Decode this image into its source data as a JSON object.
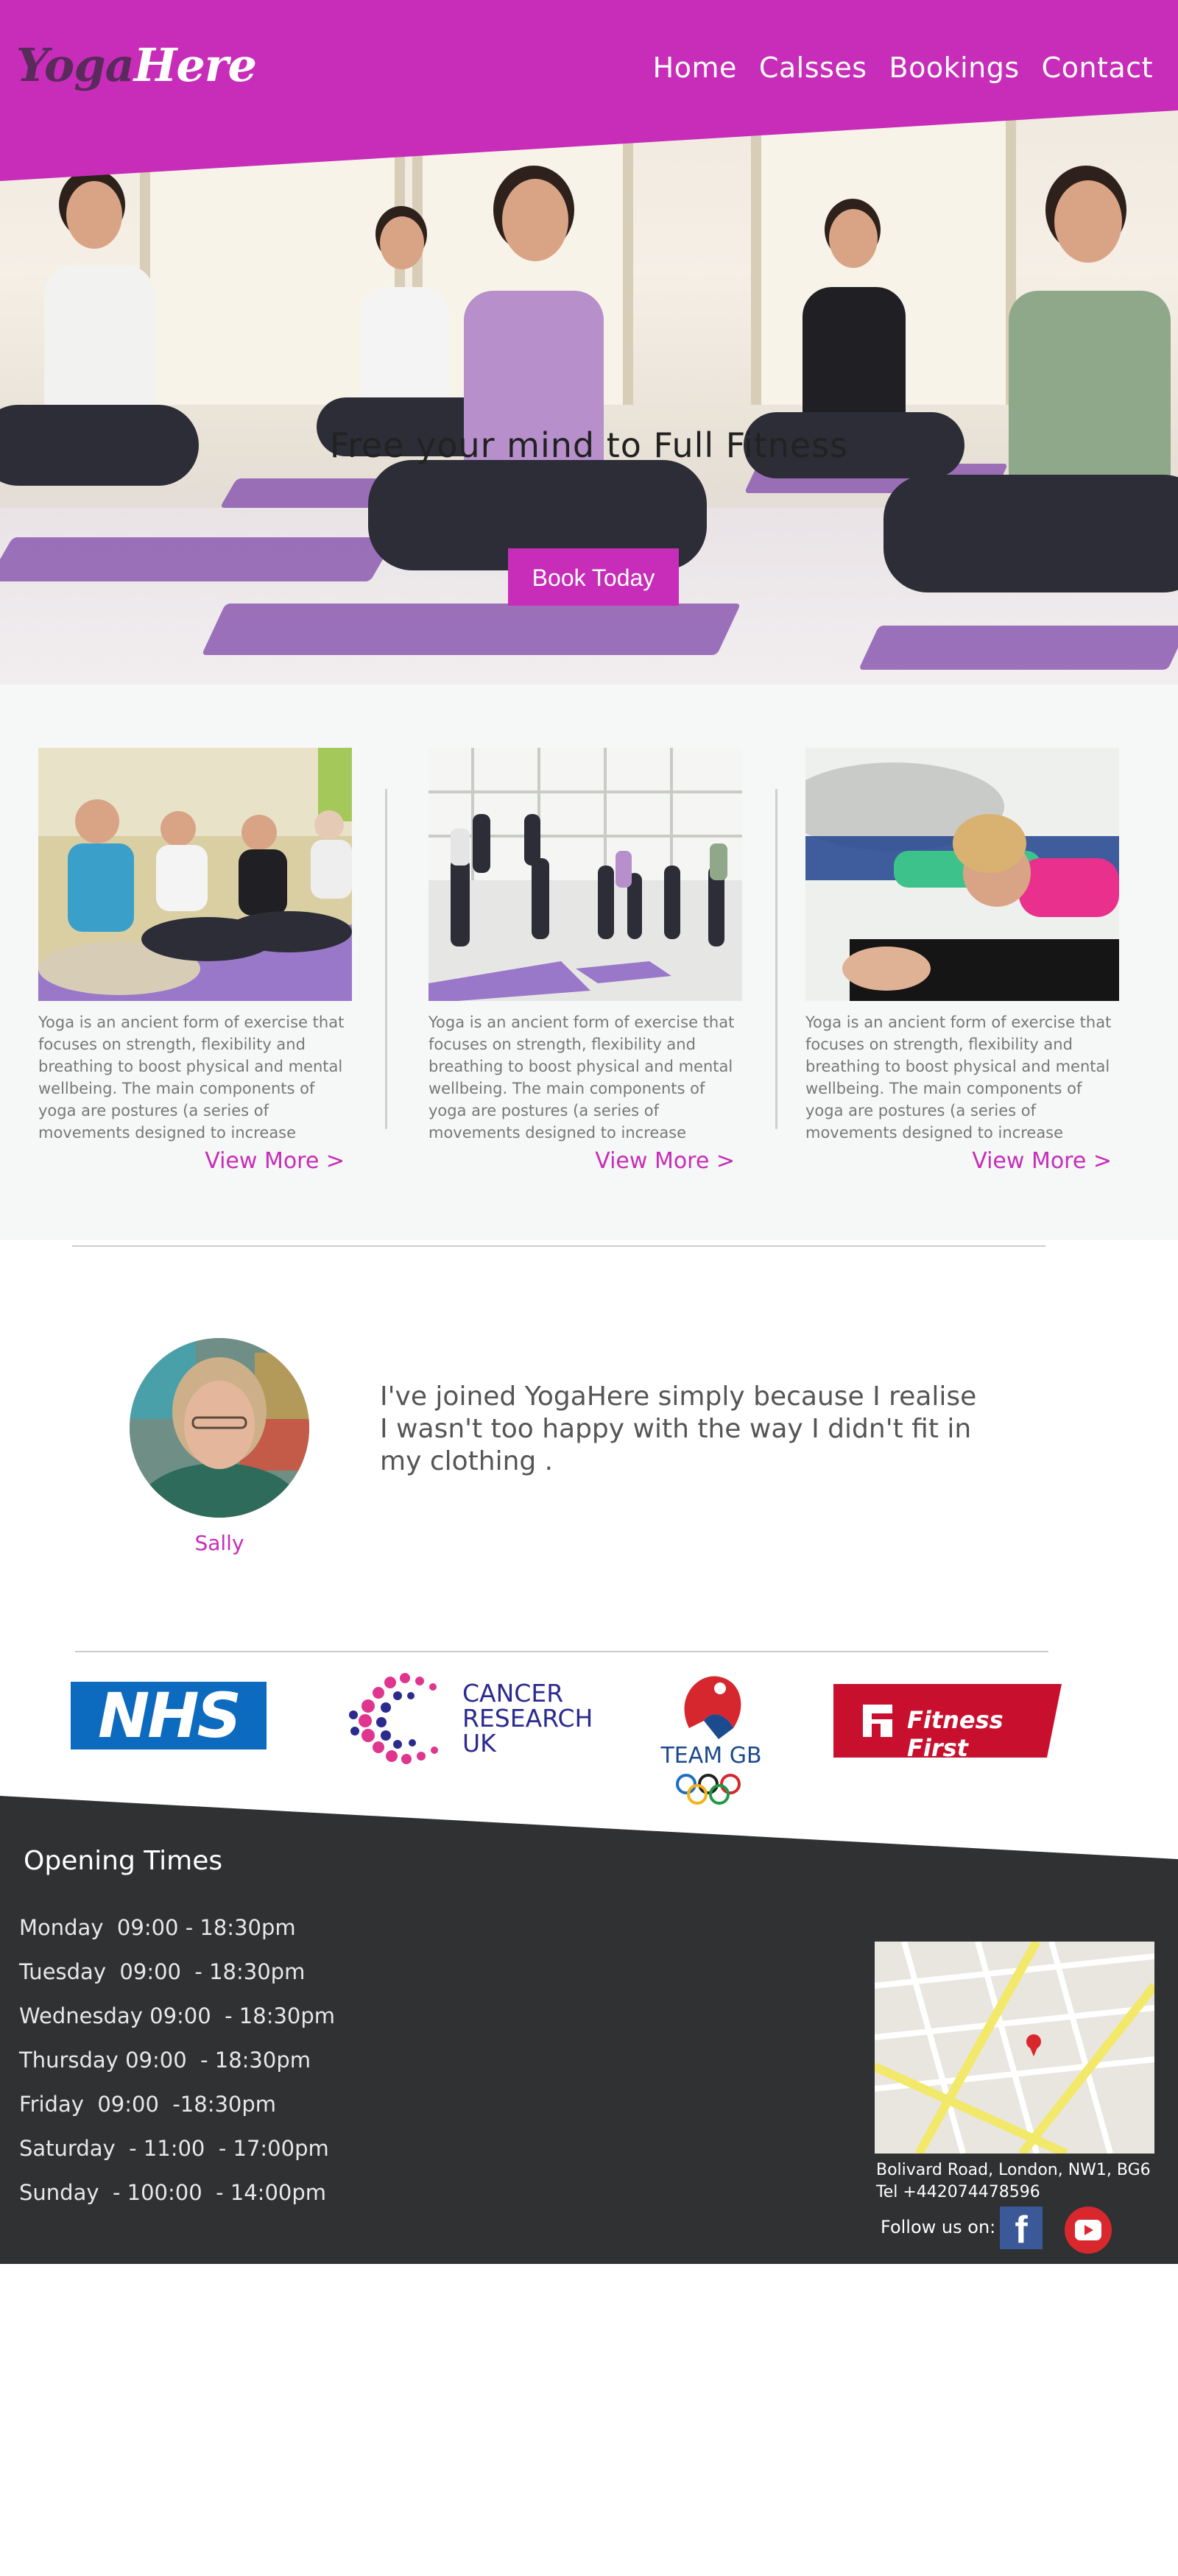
{
  "brand": {
    "logo_part1": "Yoga",
    "logo_part2": "Here",
    "accent_color": "#c72db8",
    "footer_color": "#2f3132"
  },
  "nav": [
    {
      "label": "Home"
    },
    {
      "label": "Calsses"
    },
    {
      "label": "Bookings"
    },
    {
      "label": "Contact"
    }
  ],
  "hero": {
    "title": "Free your mind to Full Fitness",
    "button_label": "Book Today",
    "slides_total": 3,
    "active_slide": 1
  },
  "cards": [
    {
      "image_desc": "seated-yoga-class-photo",
      "text": "Yoga is an ancient form of exercise that focuses on strength, flexibility and breathing to boost physical and mental wellbeing. The main components of yoga are postures (a series of movements designed to increase",
      "link_label": "View More >"
    },
    {
      "image_desc": "standing-yoga-class-photo",
      "text": "Yoga is an ancient form of exercise that focuses on strength, flexibility and breathing to boost physical and mental wellbeing. The main components of yoga are postures (a series of movements designed to increase",
      "link_label": "View More >"
    },
    {
      "image_desc": "stretching-class-photo",
      "text": "Yoga is an ancient form of exercise that focuses on strength, flexibility and breathing to boost physical and mental wellbeing. The main components of yoga are postures (a series of movements designed to increase",
      "link_label": "View More >"
    }
  ],
  "testimonial": {
    "name": "Sally",
    "quote": "I've joined YogaHere simply because I realise I wasn't too happy with the way I didn't fit in my clothing ."
  },
  "partners": {
    "nhs": "NHS",
    "cancer_research": [
      "CANCER",
      "RESEARCH",
      "UK"
    ],
    "team_gb": "TEAM GB",
    "fitness_first": "Fitness First"
  },
  "footer": {
    "opening_title": "Opening Times",
    "hours": [
      "Monday  09:00 - 18:30pm",
      "Tuesday  09:00  - 18:30pm",
      "Wednesday 09:00  - 18:30pm",
      "Thursday 09:00  - 18:30pm",
      "Friday  09:00  -18:30pm",
      "Saturday  - 11:00  - 17:00pm",
      "Sunday  - 100:00  - 14:00pm"
    ],
    "address": "Bolivard Road, London, NW1, BG6",
    "phone": "Tel +442074478596",
    "follow_label": "Follow us on:",
    "social": [
      "facebook-icon",
      "youtube-icon"
    ]
  }
}
